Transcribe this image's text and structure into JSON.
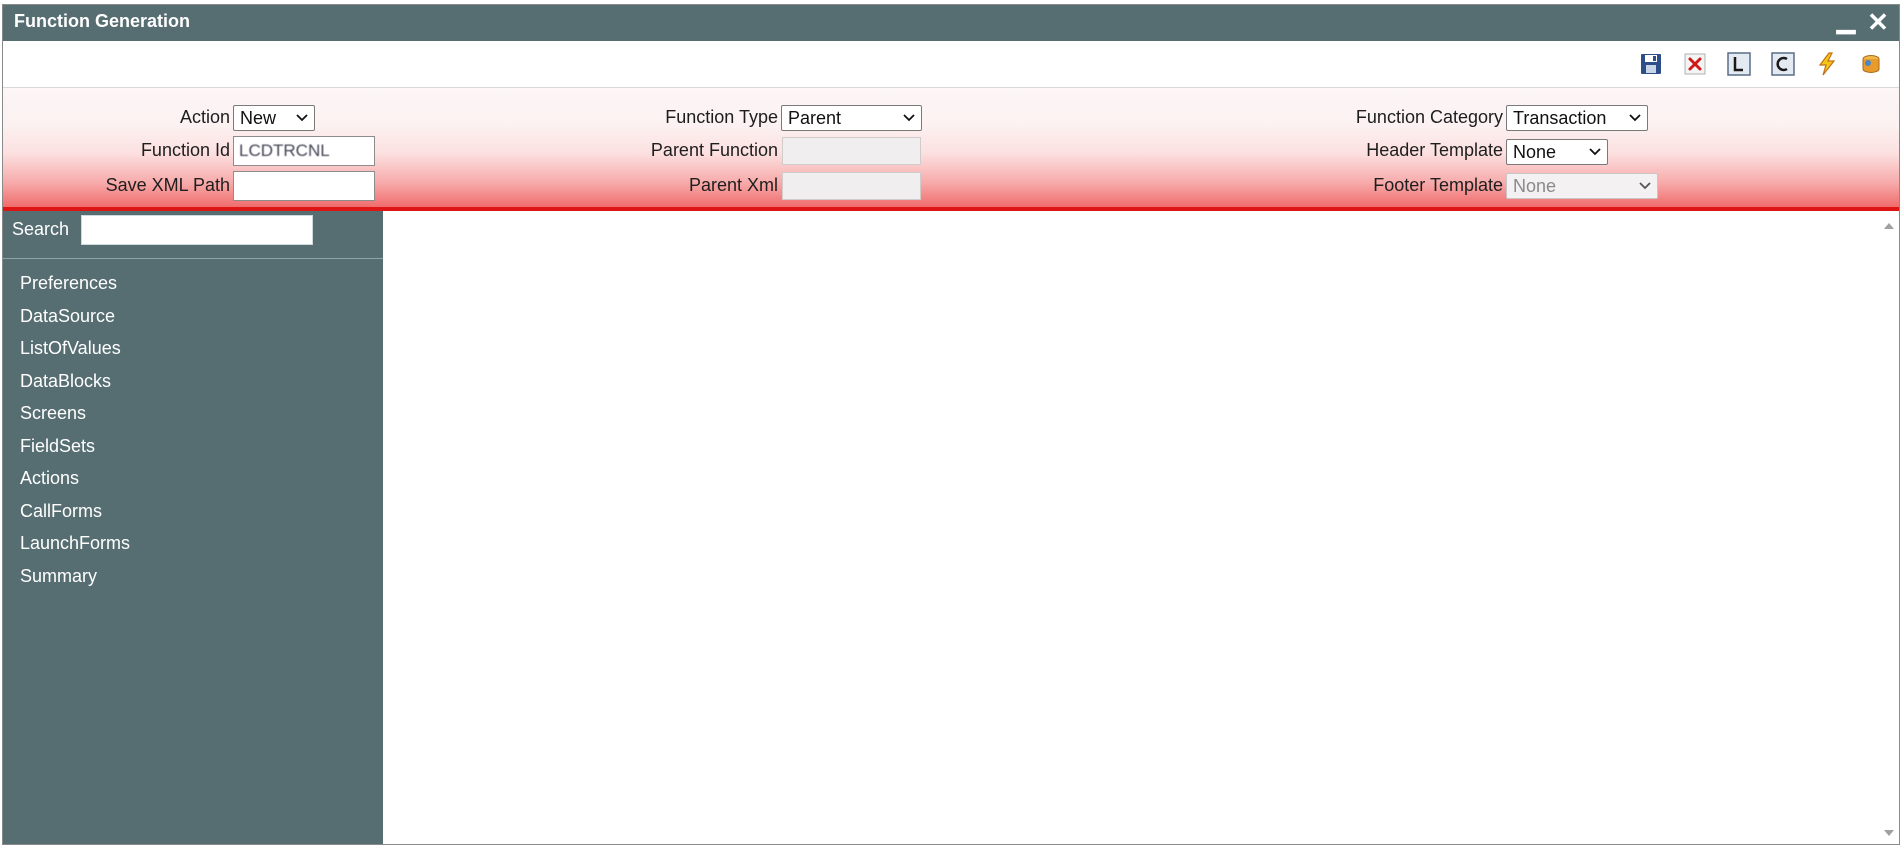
{
  "window": {
    "title": "Function Generation",
    "minimize_icon": "minimize-icon",
    "close_icon": "close-icon"
  },
  "toolbar": {
    "icons": [
      "save-icon",
      "delete-icon",
      "l-icon",
      "c-icon",
      "generate-icon",
      "deploy-icon"
    ]
  },
  "form": {
    "action_label": "Action",
    "action_value": "New",
    "function_id_label": "Function Id",
    "function_id_value": "LCDTRCNL",
    "save_xml_path_label": "Save XML Path",
    "save_xml_path_value": "",
    "function_type_label": "Function Type",
    "function_type_value": "Parent",
    "parent_function_label": "Parent Function",
    "parent_function_value": "",
    "parent_xml_label": "Parent Xml",
    "parent_xml_value": "",
    "function_category_label": "Function Category",
    "function_category_value": "Transaction",
    "header_template_label": "Header Template",
    "header_template_value": "None",
    "footer_template_label": "Footer Template",
    "footer_template_value": "None"
  },
  "sidebar": {
    "search_label": "Search",
    "search_value": "",
    "items": [
      {
        "label": "Preferences"
      },
      {
        "label": "DataSource"
      },
      {
        "label": "ListOfValues"
      },
      {
        "label": "DataBlocks"
      },
      {
        "label": "Screens"
      },
      {
        "label": "FieldSets"
      },
      {
        "label": "Actions"
      },
      {
        "label": "CallForms"
      },
      {
        "label": "LaunchForms"
      },
      {
        "label": "Summary"
      }
    ]
  },
  "colors": {
    "titlebar": "#566e72",
    "sidebar": "#566e72",
    "accent_red": "#dd1515"
  }
}
